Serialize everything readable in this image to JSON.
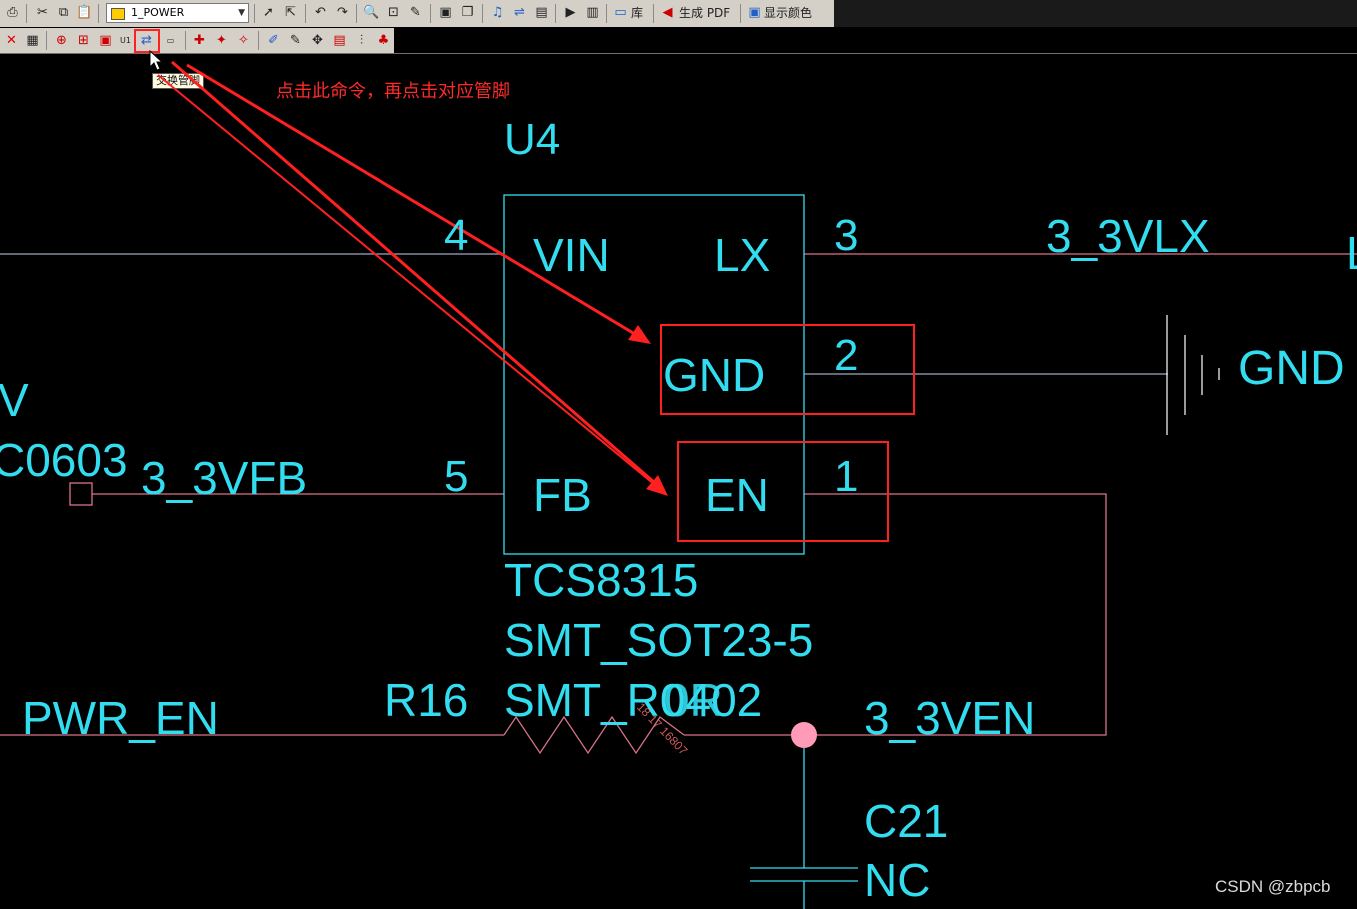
{
  "toolbar": {
    "layer_select_value": "1_POWER",
    "library_label": "库",
    "pdf_label": "生成 PDF",
    "show_color_label": "显示颜色",
    "swap_pins_tooltip": "交换管脚"
  },
  "annotation": {
    "instruction": "点击此命令，再点击对应管脚"
  },
  "schematic": {
    "u4": {
      "refdes": "U4",
      "part": "TCS8315",
      "footprint": "SMT_SOT23-5",
      "pins": [
        {
          "number": "4",
          "name": "VIN"
        },
        {
          "number": "3",
          "name": "LX"
        },
        {
          "number": "2",
          "name": "GND"
        },
        {
          "number": "1",
          "name": "EN"
        },
        {
          "number": "5",
          "name": "FB"
        }
      ]
    },
    "nets": {
      "lx": "3_3VLX",
      "gnd": "GND",
      "fb": "3_3VFB",
      "pwr_en": "PWR_EN",
      "en": "3_3VEN"
    },
    "r16": {
      "refdes": "R16",
      "footprint": "SMT_R0402",
      "value": "0R"
    },
    "c21": {
      "refdes": "C21",
      "value": "NC"
    },
    "left_partial": {
      "text1": "V",
      "text2": "C0603"
    },
    "right_partial": "L",
    "rotated_text": "18 17 16807"
  },
  "watermark": "CSDN @zbpcb",
  "colors": {
    "component": "#33ddf0",
    "wire": "#d9738a",
    "highlight": "#ff2020",
    "junction": "#ff9ab8",
    "background": "#000000"
  }
}
